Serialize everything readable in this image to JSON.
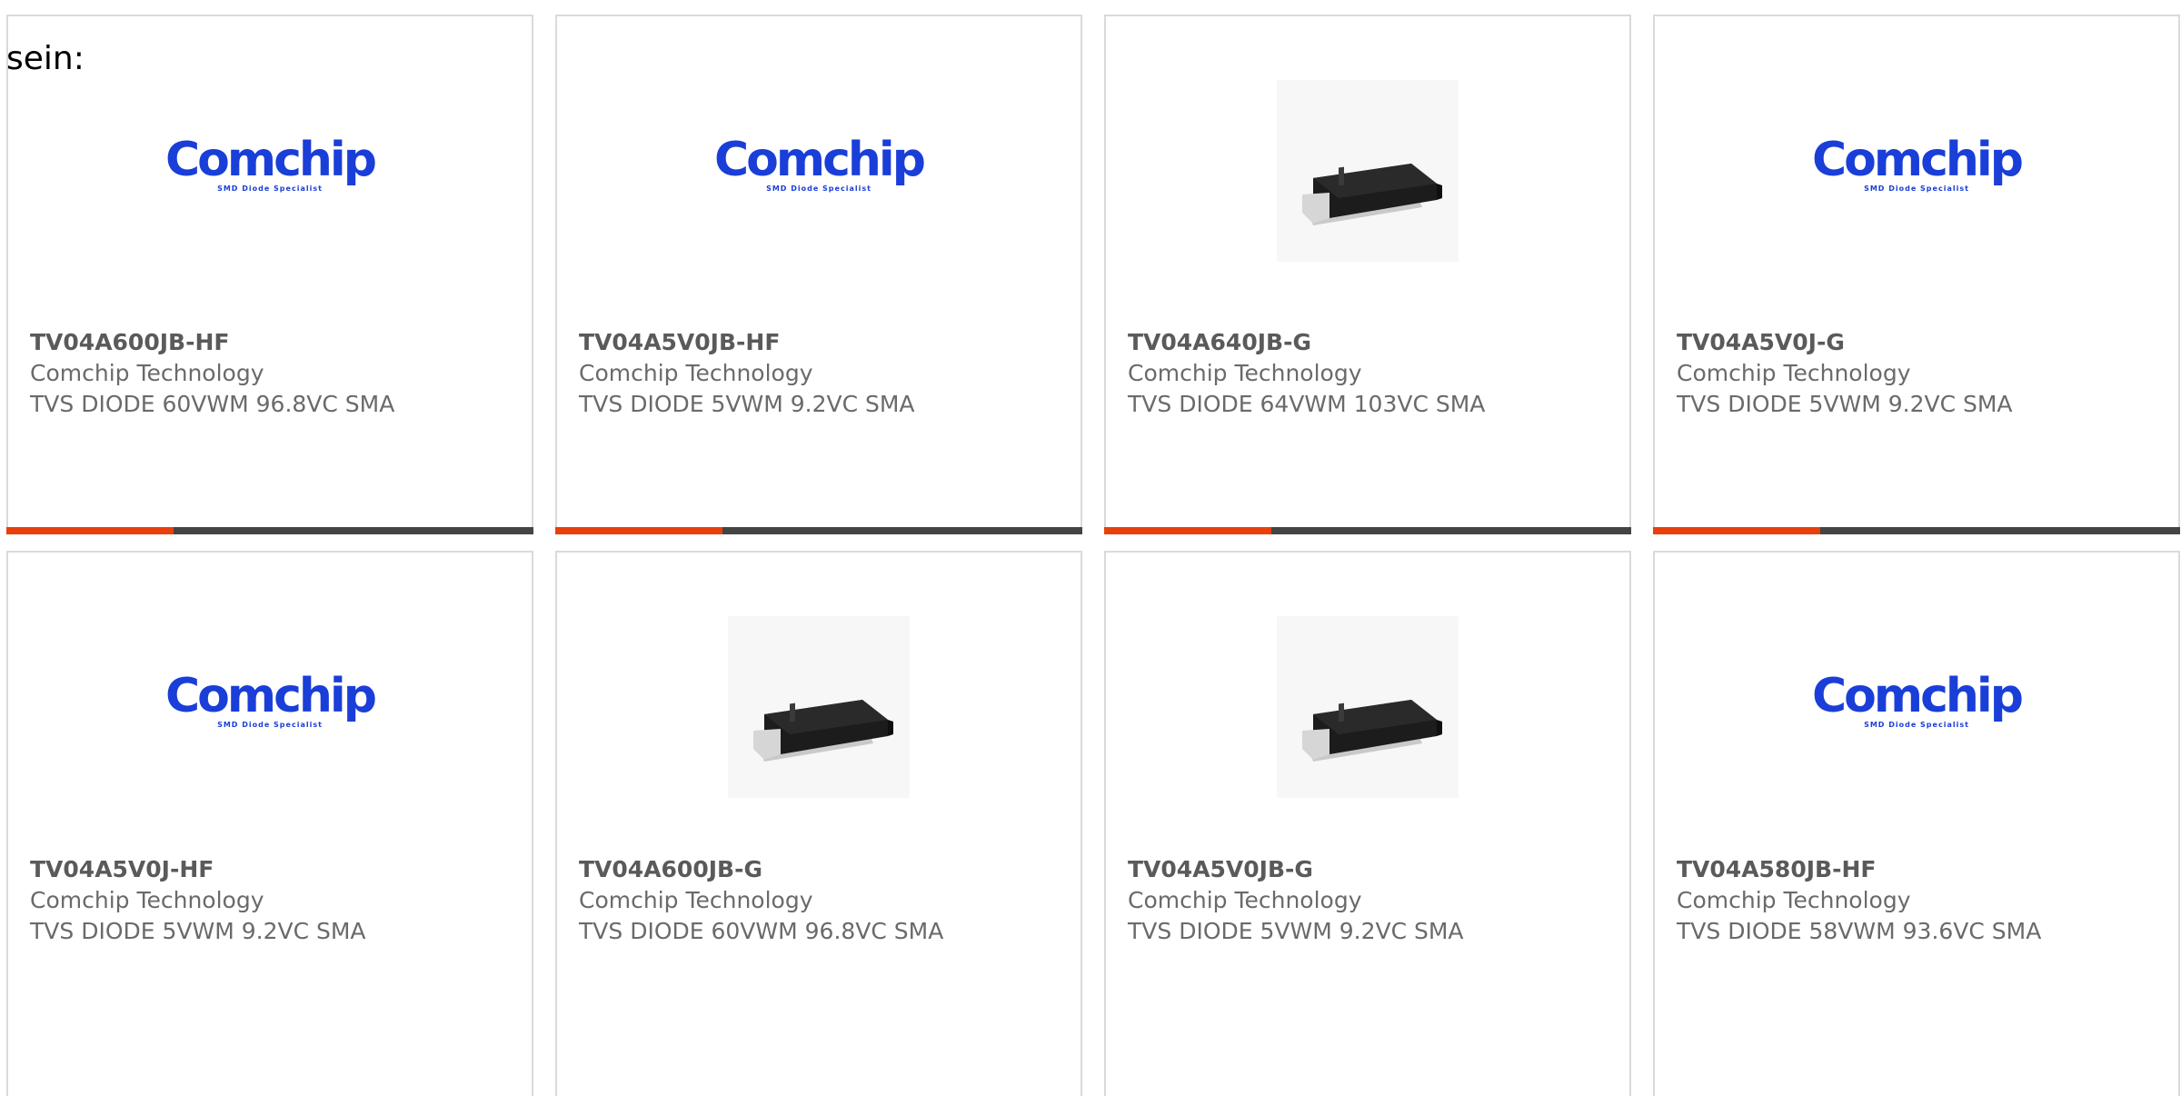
{
  "lead_text": "sein:",
  "colors": {
    "accent": "#e8400c",
    "bar": "#444444",
    "logo_blue": "#1a3ed8",
    "card_border": "#dadada"
  },
  "logo": {
    "word": "Comchip",
    "tagline": "SMD Diode Specialist"
  },
  "products": [
    {
      "part": "TV04A600JB-HF",
      "manufacturer": "Comchip Technology",
      "description": "TVS DIODE 60VWM 96.8VC SMA",
      "image": "comchip-logo"
    },
    {
      "part": "TV04A5V0JB-HF",
      "manufacturer": "Comchip Technology",
      "description": "TVS DIODE 5VWM 9.2VC SMA",
      "image": "comchip-logo"
    },
    {
      "part": "TV04A640JB-G",
      "manufacturer": "Comchip Technology",
      "description": "TVS DIODE 64VWM 103VC SMA",
      "image": "sma-diode-photo"
    },
    {
      "part": "TV04A5V0J-G",
      "manufacturer": "Comchip Technology",
      "description": "TVS DIODE 5VWM 9.2VC SMA",
      "image": "comchip-logo"
    },
    {
      "part": "TV04A5V0J-HF",
      "manufacturer": "Comchip Technology",
      "description": "TVS DIODE 5VWM 9.2VC SMA",
      "image": "comchip-logo"
    },
    {
      "part": "TV04A600JB-G",
      "manufacturer": "Comchip Technology",
      "description": "TVS DIODE 60VWM 96.8VC SMA",
      "image": "sma-diode-photo"
    },
    {
      "part": "TV04A5V0JB-G",
      "manufacturer": "Comchip Technology",
      "description": "TVS DIODE 5VWM 9.2VC SMA",
      "image": "sma-diode-photo"
    },
    {
      "part": "TV04A580JB-HF",
      "manufacturer": "Comchip Technology",
      "description": "TVS DIODE 58VWM 93.6VC SMA",
      "image": "comchip-logo"
    }
  ]
}
